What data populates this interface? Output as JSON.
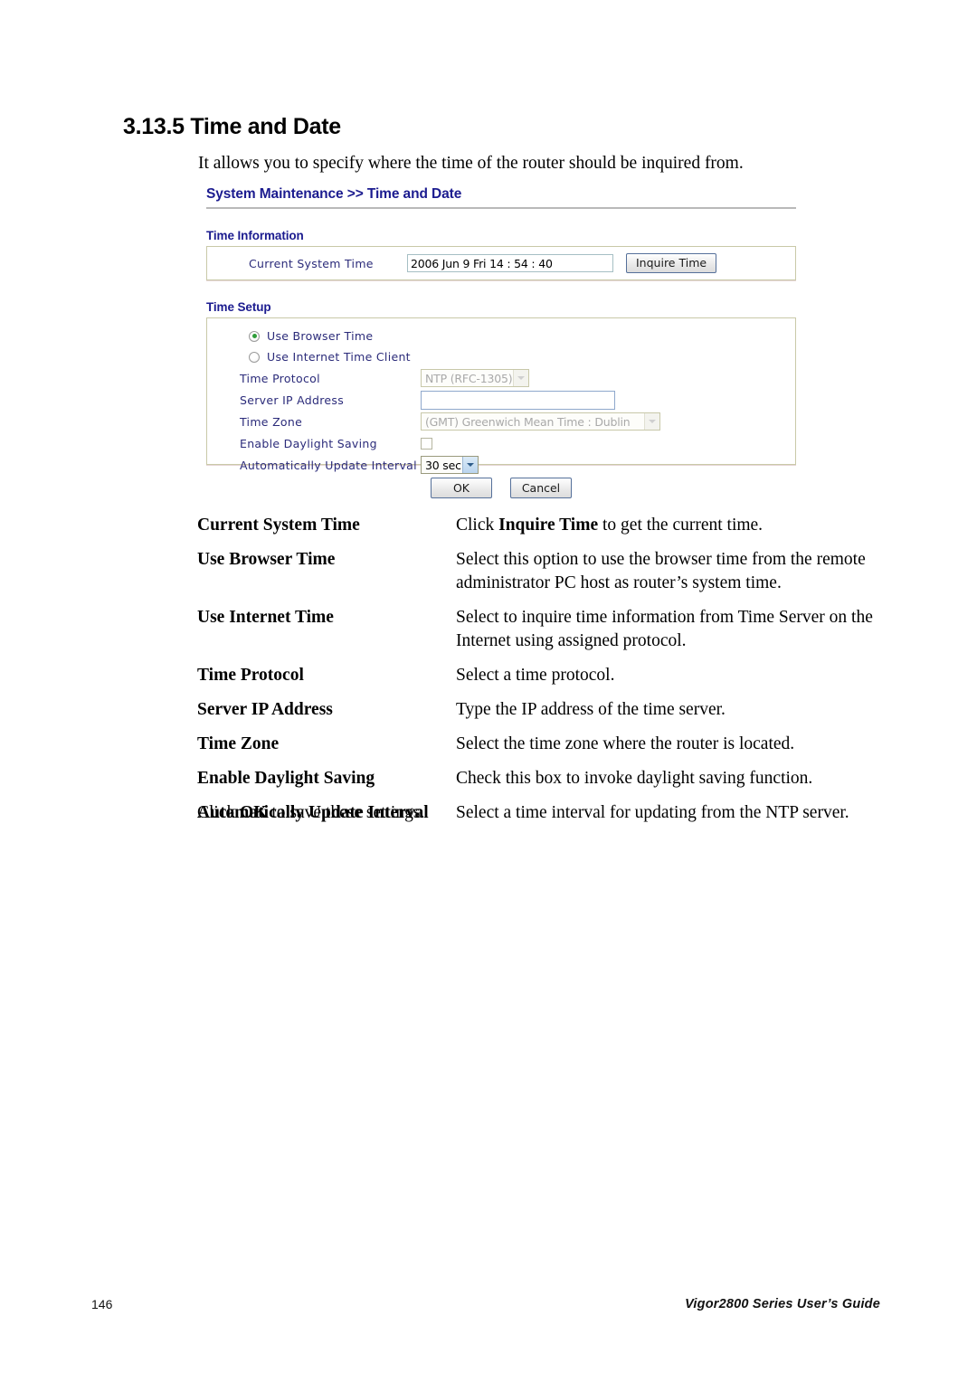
{
  "document": {
    "section_number": "3.13.5",
    "section_title": "3.13.5 Time and Date",
    "intro": "It allows you to specify where the time of the router should be inquired from."
  },
  "router_ui": {
    "breadcrumb": "System Maintenance >> Time and Date",
    "time_information": {
      "group_title": "Time Information",
      "current_system_time_label": "Current System Time",
      "current_system_time_value": "2006 Jun 9 Fri 14 : 54 : 40",
      "inquire_button": "Inquire Time"
    },
    "time_setup": {
      "group_title": "Time Setup",
      "radio_browser": "Use Browser Time",
      "radio_internet": "Use Internet Time Client",
      "radio_selected": "Use Browser Time",
      "time_protocol_label": "Time Protocol",
      "time_protocol_value": "NTP (RFC-1305)",
      "server_ip_label": "Server IP Address",
      "server_ip_value": "",
      "time_zone_label": "Time Zone",
      "time_zone_value": "(GMT) Greenwich Mean Time : Dublin",
      "daylight_label": "Enable Daylight Saving",
      "daylight_checked": false,
      "interval_label": "Automatically Update Interval",
      "interval_value": "30 sec"
    },
    "buttons": {
      "ok": "OK",
      "cancel": "Cancel"
    },
    "accent_link_color": "#1b1b8f",
    "radio_dot_color": "#2f9d3a"
  },
  "definitions": [
    {
      "term": "Current System Time",
      "desc_pre": "Click ",
      "desc_bold": "Inquire Time",
      "desc_post": " to get the current time."
    },
    {
      "term": "Use Browser Time",
      "desc_pre": "Select this option to use the browser time from the remote administrator PC host as router’s system time.",
      "desc_bold": "",
      "desc_post": ""
    },
    {
      "term": "Use Internet Time",
      "desc_pre": "Select to inquire time information from Time Server on the Internet using assigned protocol.",
      "desc_bold": "",
      "desc_post": ""
    },
    {
      "term": "Time Protocol",
      "desc_pre": "Select a time protocol.",
      "desc_bold": "",
      "desc_post": ""
    },
    {
      "term": "Server IP Address",
      "desc_pre": "Type the IP address of the time server.",
      "desc_bold": "",
      "desc_post": ""
    },
    {
      "term": "Time Zone",
      "desc_pre": "Select the time zone where the router is located.",
      "desc_bold": "",
      "desc_post": ""
    },
    {
      "term": "Enable Daylight Saving",
      "desc_pre": "Check this box to invoke daylight saving function.",
      "desc_bold": "",
      "desc_post": ""
    },
    {
      "term": "Automatically Update Interval",
      "desc_pre": "Select a time interval for updating from the NTP server.",
      "desc_bold": "",
      "desc_post": ""
    }
  ],
  "closing": {
    "pre": "Click ",
    "bold": "OK",
    "post": " to save these settings."
  },
  "footer": {
    "page_number": "146",
    "guide_title": "Vigor2800 Series User’s Guide"
  }
}
